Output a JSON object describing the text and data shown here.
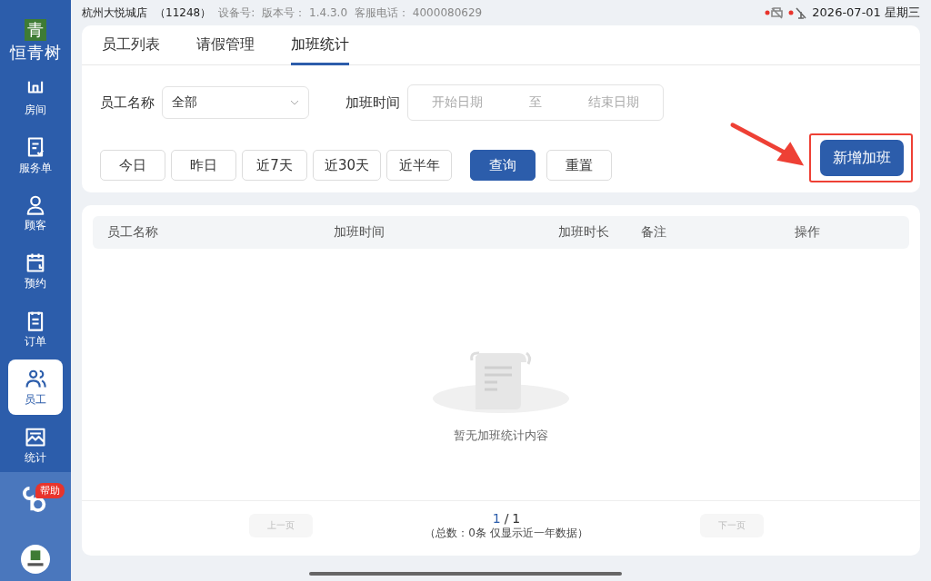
{
  "sidebar": {
    "logo_char": "青",
    "brand": "恒青树",
    "items": [
      {
        "label": "房间",
        "selected": false
      },
      {
        "label": "服务单",
        "selected": false
      },
      {
        "label": "顾客",
        "selected": false
      },
      {
        "label": "预约",
        "selected": false
      },
      {
        "label": "订单",
        "selected": false
      },
      {
        "label": "员工",
        "selected": true
      },
      {
        "label": "统计",
        "selected": false
      }
    ],
    "help_badge": "帮助"
  },
  "top_bar": {
    "store": "杭州大悦城店",
    "store_code": "（11248）",
    "device": "设备号:",
    "version": "版本号： 1.4.3.0",
    "service_phone": "客服电话： 4000080629",
    "datetime": "2026-07-01 星期三"
  },
  "tabs": [
    {
      "label": "员工列表",
      "selected": false
    },
    {
      "label": "请假管理",
      "selected": false
    },
    {
      "label": "加班统计",
      "selected": true
    }
  ],
  "filters": {
    "employee_label": "员工名称",
    "employee_value": "全部",
    "time_label": "加班时间",
    "start_placeholder": "开始日期",
    "range_sep": "至",
    "end_placeholder": "结束日期"
  },
  "quick_ranges": [
    {
      "label": "今日",
      "selected": false
    },
    {
      "label": "昨日",
      "selected": false
    },
    {
      "label": "近7天",
      "selected": false
    },
    {
      "label": "近30天",
      "selected": false
    },
    {
      "label": "近半年",
      "selected": false
    }
  ],
  "query_button": "查询",
  "reset_button": "重置",
  "add_button": "新增加班",
  "table": {
    "columns": [
      "员工名称",
      "加班时间",
      "加班时长",
      "备注",
      "操作"
    ],
    "empty_text": "暂无加班统计内容"
  },
  "pager": {
    "prev": "上一页",
    "current": "1",
    "separator": "/",
    "total": "1",
    "summary": "（总数：0条 仅显示近一年数据）",
    "next": "下一页"
  }
}
